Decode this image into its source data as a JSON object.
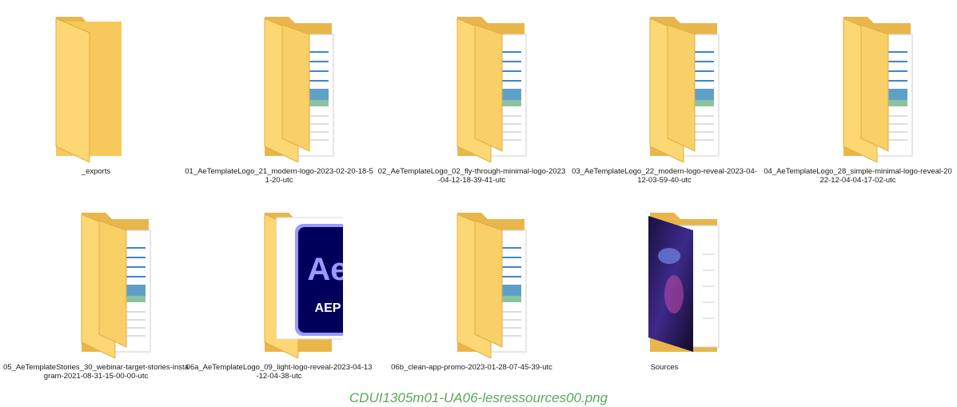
{
  "window": {
    "title": ""
  },
  "folders": [
    {
      "name": "_exports",
      "kind": "empty-folder"
    },
    {
      "name": "01_AeTemplateLogo_21_modern-logo-2023-02-20-18-51-20-utc",
      "kind": "doc-folder"
    },
    {
      "name": "02_AeTemplateLogo_02_fly-through-minimal-logo-2023-04-12-18-39-41-utc",
      "kind": "doc-folder"
    },
    {
      "name": "03_AeTemplateLogo_22_modern-logo-reveal-2023-04-12-03-59-40-utc",
      "kind": "doc-folder"
    },
    {
      "name": "04_AeTemplateLogo_28_simple-minimal-logo-reveal-2022-12-04-04-17-02-utc",
      "kind": "doc-folder"
    },
    {
      "name": "05_AeTemplateStories_30_webinar-target-stories-instagram-2021-08-31-15-00-00-utc",
      "kind": "doc-folder"
    },
    {
      "name": "06a_AeTemplateLogo_09_light-logo-reveal-2023-04-13-12-04-38-utc",
      "kind": "aep-folder"
    },
    {
      "name": "06b_clean-app-promo-2023-01-28-07-45-39-utc",
      "kind": "doc-folder"
    },
    {
      "name": "Sources",
      "kind": "photo-folder"
    }
  ],
  "aep_icon": {
    "big": "Ae",
    "small": "AEP"
  },
  "caption": "CDUI1305m01-UA06-lesressources00.png",
  "colors": {
    "folder_back": "#E8B64A",
    "folder_front": "#FCD774",
    "ae_bg": "#00005B",
    "ae_accent": "#9999FF",
    "caption": "#5AA75A"
  }
}
